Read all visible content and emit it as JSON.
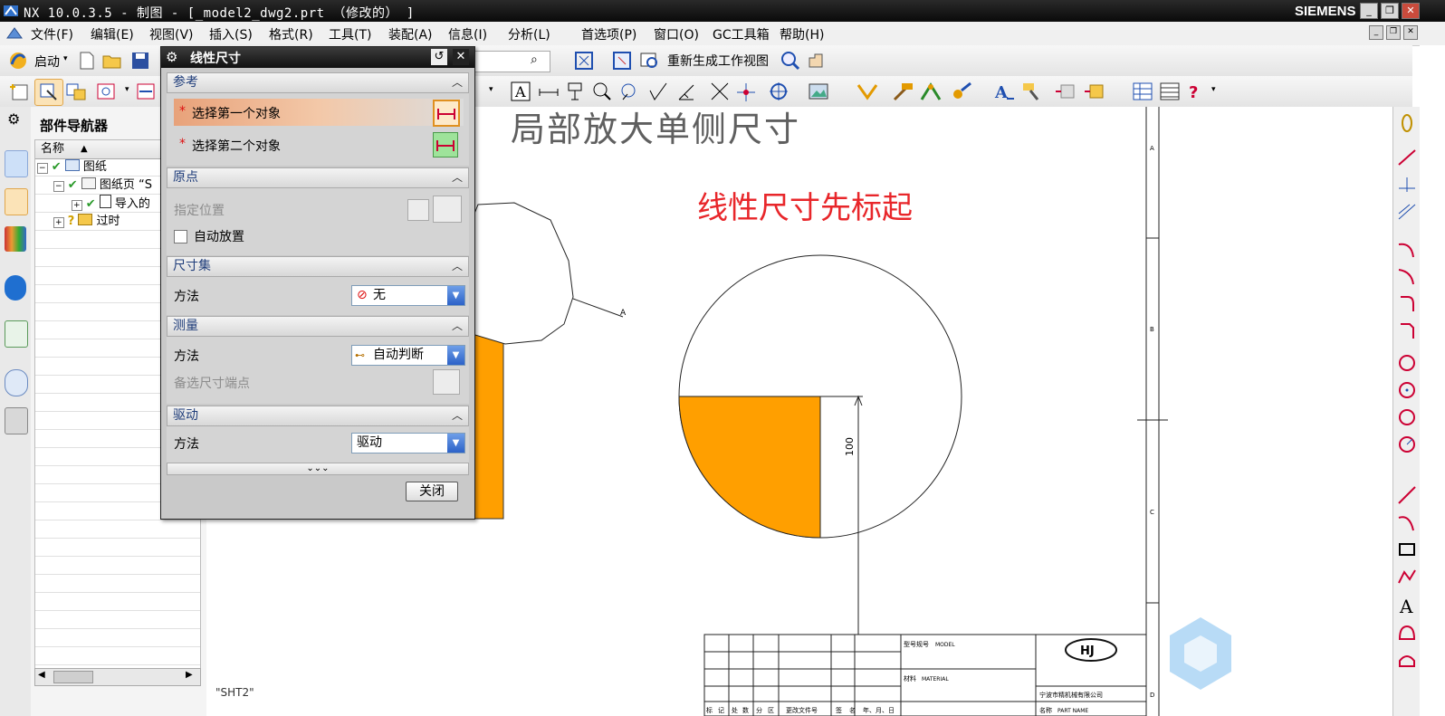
{
  "window": {
    "title": "NX 10.0.3.5 - 制图 - [_model2_dwg2.prt （修改的） ]",
    "brand": "SIEMENS"
  },
  "menubar": {
    "items": [
      "文件(F)",
      "编辑(E)",
      "视图(V)",
      "插入(S)",
      "格式(R)",
      "工具(T)",
      "装配(A)",
      "信息(I)",
      "分析(L)",
      "首选项(P)",
      "窗口(O)",
      "GC工具箱",
      "帮助(H)"
    ]
  },
  "toolbar": {
    "start_label": "启动",
    "regen_label": "重新生成工作视图"
  },
  "navigator": {
    "title": "部件导航器",
    "column_name": "名称",
    "tree": [
      {
        "label": "图纸"
      },
      {
        "label": "图纸页 “S"
      },
      {
        "label": "导入的"
      },
      {
        "label": "过时"
      }
    ]
  },
  "dialog": {
    "title": "线性尺寸",
    "sections": {
      "reference": "参考",
      "origin": "原点",
      "dimset": "尺寸集",
      "measure": "测量",
      "driving": "驱动"
    },
    "select_first": "选择第一个对象",
    "select_second": "选择第二个对象",
    "required_mark": "*",
    "specify_location": "指定位置",
    "auto_place": "自动放置",
    "method_label": "方法",
    "dimset_method": "无",
    "measure_method": "自动判断",
    "alt_endpoint": "备选尺寸端点",
    "driving_method": "驱动",
    "close_button": "关闭"
  },
  "drawing": {
    "heading": "局部放大单侧尺寸",
    "annotation": "线性尺寸先标起",
    "dimension_value": "100",
    "sheet_label": "\"SHT2\"",
    "view_label": "A",
    "border_letters": [
      "A",
      "B",
      "C",
      "D"
    ],
    "titleblock": {
      "model_label": "型号规号",
      "model_value": "MODEL",
      "material_label": "材料",
      "material_value": "MATERIAL",
      "part_label": "名称",
      "part_value": "PART NAME",
      "company": "宁波市精机械有限公司",
      "logo_text": "HJ",
      "col_headers": [
        "标",
        "记",
        "处",
        "数",
        "分",
        "区",
        "更改文件号",
        "签",
        "名",
        "年、月、日"
      ]
    },
    "accent_color": "#ff9f00",
    "annotation_color": "#e8262a"
  }
}
